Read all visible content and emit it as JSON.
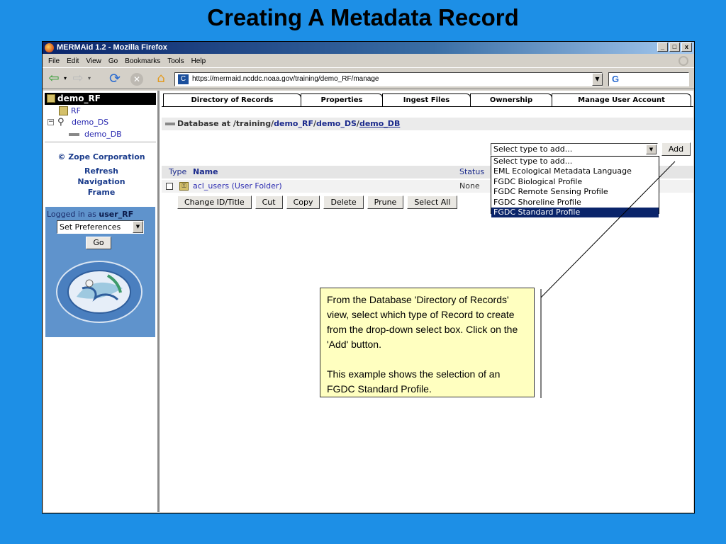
{
  "slide": {
    "title": "Creating A Metadata Record"
  },
  "window": {
    "title": "MERMAid 1.2 - Mozilla Firefox",
    "controls": [
      "_",
      "□",
      "x"
    ]
  },
  "menu": [
    "File",
    "Edit",
    "View",
    "Go",
    "Bookmarks",
    "Tools",
    "Help"
  ],
  "nav": {
    "url": "https://mermaid.ncddc.noaa.gov/training/demo_RF/manage"
  },
  "tree": {
    "root": "demo_RF",
    "items": [
      "RF",
      "demo_DS",
      "demo_DB"
    ],
    "toggle": "−"
  },
  "left": {
    "zope": "© Zope Corporation",
    "refresh": "Refresh\nNavigation\nFrame",
    "logged_in_label": "Logged in as",
    "user": "user_RF",
    "prefs_value": "Set Preferences",
    "go_label": "Go"
  },
  "tabs": [
    "Directory of Records",
    "Properties",
    "Ingest Files",
    "Ownership",
    "Manage User Account"
  ],
  "path": {
    "label": "Database at",
    "prefix": "/training/",
    "p1": "demo_RF",
    "sep1": "/",
    "p2": "demo_DS",
    "sep2": "/",
    "p3": "demo_DB"
  },
  "add": {
    "select_value": "Select type to add...",
    "button_label": "Add",
    "options": [
      "Select type to add...",
      "EML Ecological Metadata Language",
      "FGDC Biological Profile",
      "FGDC Remote Sensing Profile",
      "FGDC Shoreline Profile",
      "FGDC Standard Profile"
    ],
    "selected_index": 5
  },
  "listing": {
    "headers": {
      "type": "Type",
      "name": "Name",
      "status": "Status"
    },
    "rows": [
      {
        "name": "acl_users (User Folder)",
        "status": "None"
      }
    ]
  },
  "actions": [
    "Change ID/Title",
    "Cut",
    "Copy",
    "Delete",
    "Prune",
    "Select All"
  ],
  "callout": {
    "p1": "From the Database 'Directory of Records' view, select which type of Record to create from the drop-down select box.  Click on the 'Add' button.",
    "p2": "This example shows the selection of an FGDC Standard Profile."
  },
  "colors": {
    "slide_bg": "#1d8fe6",
    "selection": "#0a246a",
    "callout_bg": "#ffffc0",
    "login_panel": "#5f93cc"
  }
}
